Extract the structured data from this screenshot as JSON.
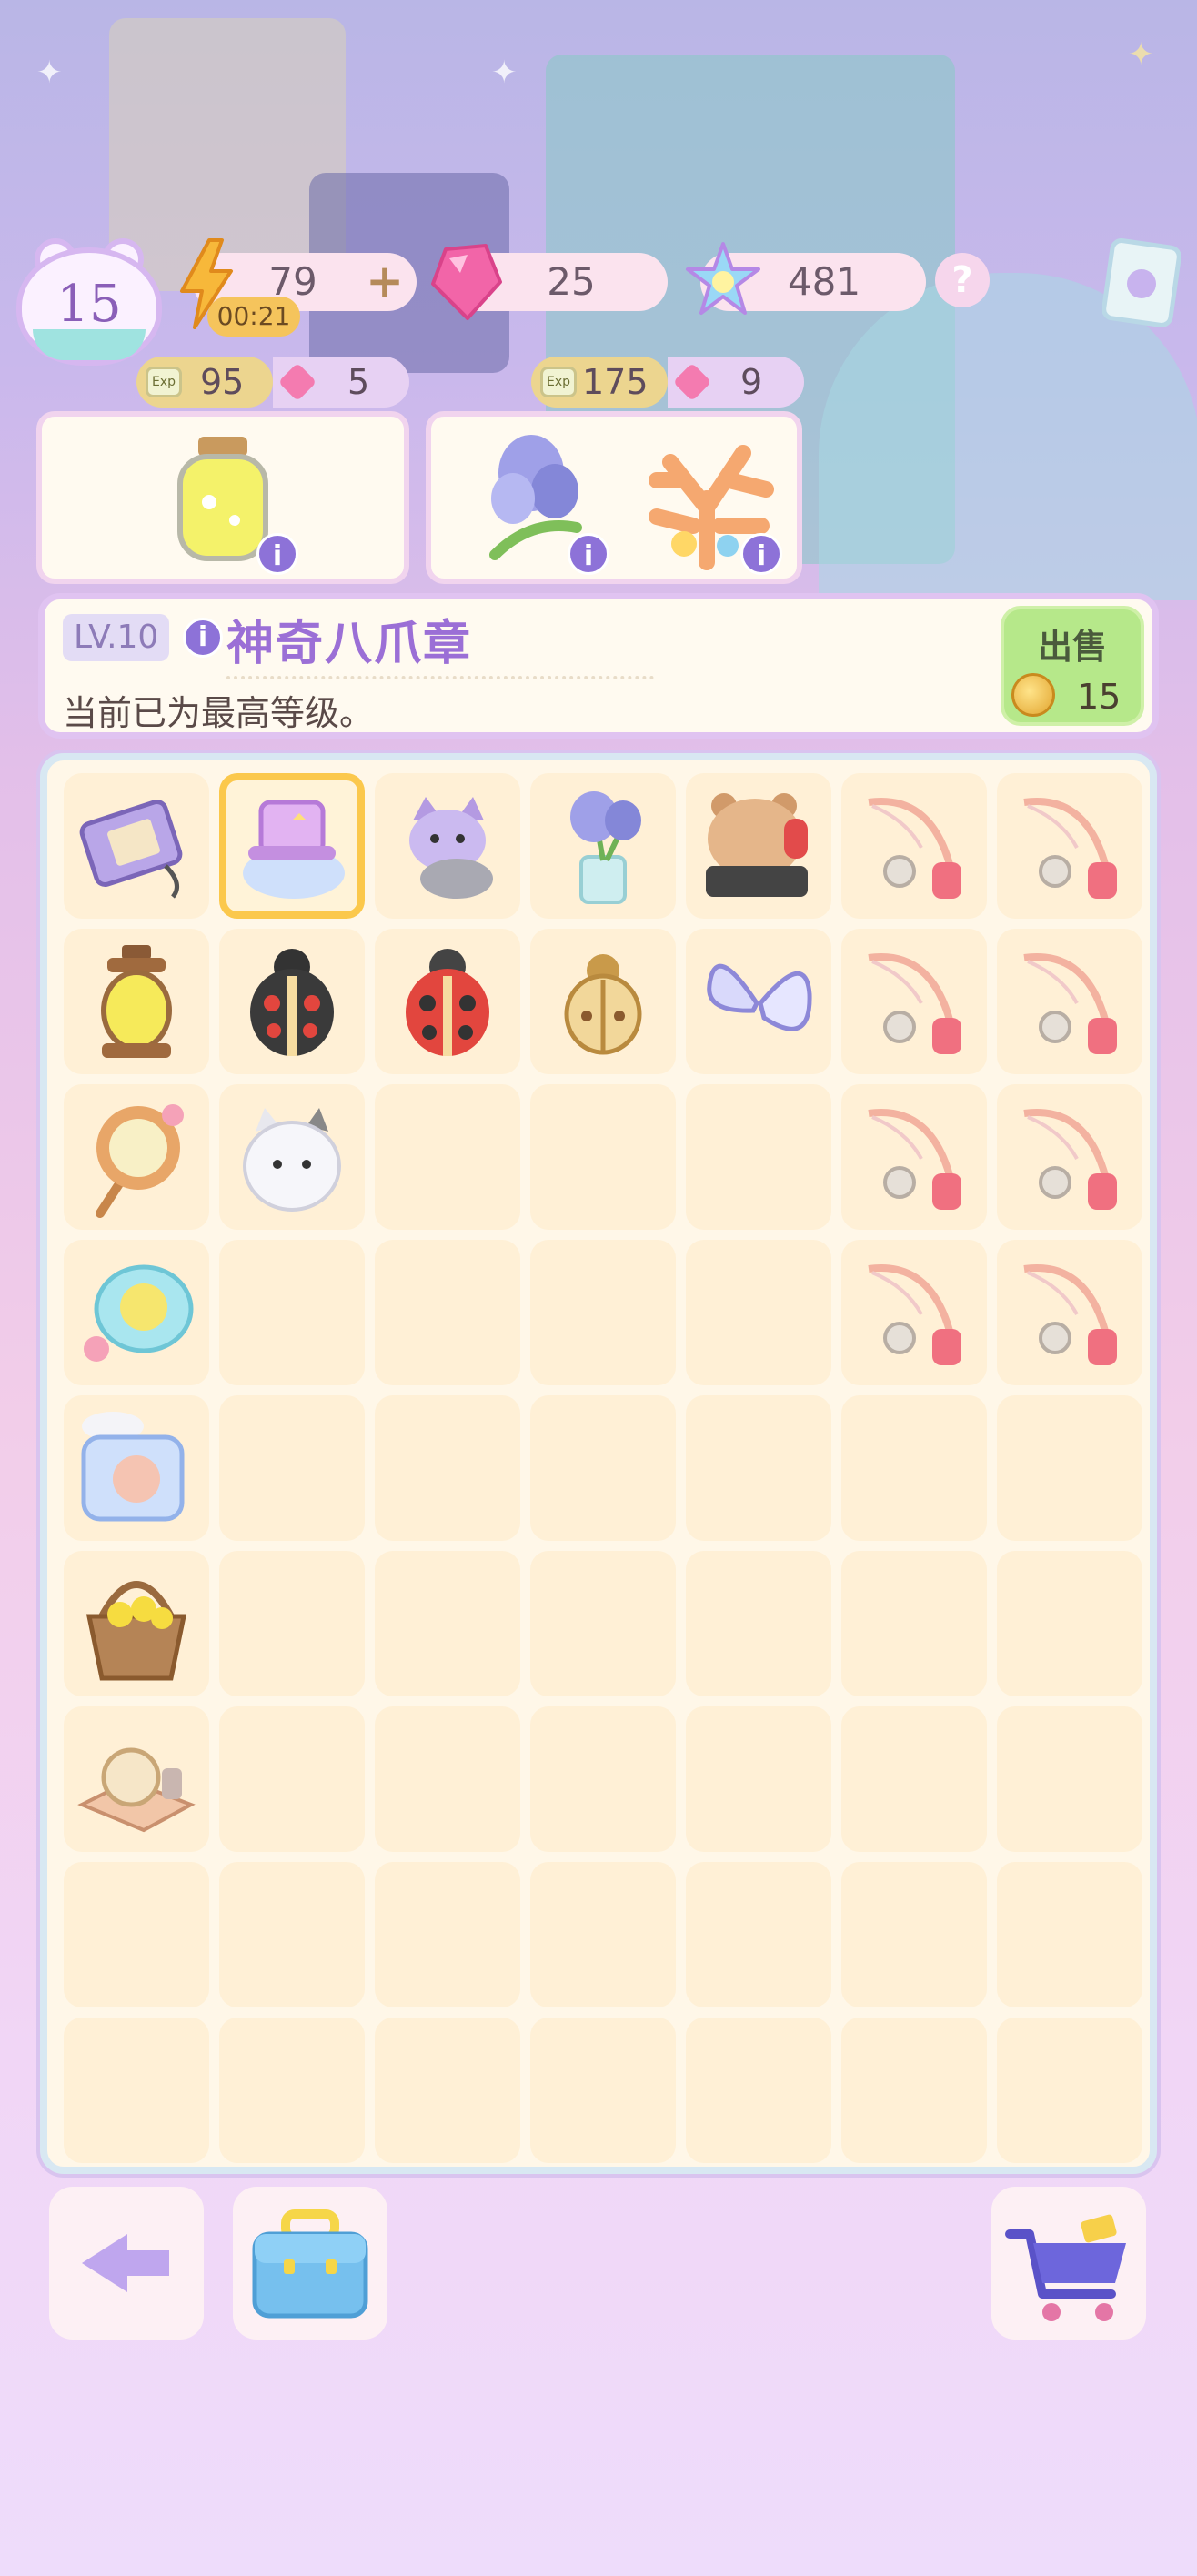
{
  "player": {
    "level": "15"
  },
  "resources": {
    "energy": "79",
    "energy_timer": "00:21",
    "gems": "25",
    "stars": "481",
    "help": "?"
  },
  "rewards": [
    {
      "exp_icon": "Exp",
      "exp": "95",
      "gem": "5"
    },
    {
      "exp_icon": "Exp",
      "exp": "175",
      "gem": "9"
    }
  ],
  "info_glyph": "i",
  "detail": {
    "level": "LV.10",
    "title": "神奇八爪章",
    "description": "当前已为最高等级。",
    "sell_label": "出售",
    "sell_price": "15"
  },
  "colors": {
    "accent_purple": "#9b6fd6",
    "sell_green": "#b6e88a",
    "selection_yellow": "#fbc84c",
    "board_cell": "#fff0d6"
  },
  "board": {
    "rows": [
      [
        "photo-album-icon",
        "magician-hat-cloud-icon",
        "purple-cat-icon",
        "iris-vase-icon",
        "bear-phone-icon",
        "fishing-rod-icon",
        "fishing-rod-icon"
      ],
      [
        "lantern-icon",
        "black-ladybug-icon",
        "red-ladybug-icon",
        "golden-beetle-icon",
        "butterfly-icon",
        "fishing-rod-icon",
        "fishing-rod-icon"
      ],
      [
        "hand-mirror-icon",
        "white-cat-ghost-icon",
        "",
        "",
        "",
        "fishing-rod-icon",
        "fishing-rod-icon"
      ],
      [
        "lemon-plate-icon",
        "",
        "",
        "",
        "",
        "fishing-rod-icon",
        "fishing-rod-icon"
      ],
      [
        "coffee-machine-icon",
        "",
        "",
        "",
        "",
        "",
        ""
      ],
      [
        "flower-basket-icon",
        "",
        "",
        "",
        "",
        "",
        ""
      ],
      [
        "tape-stand-icon",
        "",
        "",
        "",
        "",
        "",
        ""
      ],
      [
        "",
        "",
        "",
        "",
        "",
        "",
        ""
      ],
      [
        "",
        "",
        "",
        "",
        "",
        "",
        ""
      ]
    ],
    "selected": [
      0,
      1
    ]
  }
}
